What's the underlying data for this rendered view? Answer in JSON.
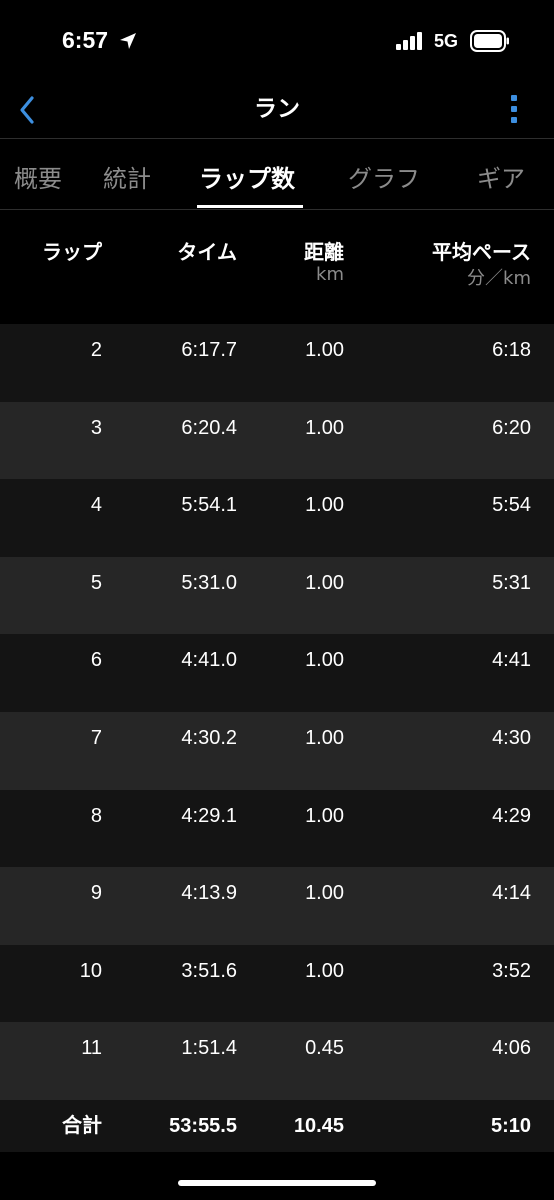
{
  "status_bar": {
    "time": "6:57",
    "network": "5G"
  },
  "nav": {
    "title": "ラン"
  },
  "tabs": [
    {
      "label": "概要"
    },
    {
      "label": "統計"
    },
    {
      "label": "ラップ数"
    },
    {
      "label": "グラフ"
    },
    {
      "label": "ギア"
    }
  ],
  "active_tab": "ラップ数",
  "table": {
    "headers": {
      "lap": "ラップ",
      "time": "タイム",
      "distance": "距離",
      "distance_unit": "km",
      "pace": "平均ペース",
      "pace_unit": "分／km"
    },
    "rows": [
      {
        "lap": "2",
        "time": "6:17.7",
        "distance": "1.00",
        "pace": "6:18"
      },
      {
        "lap": "3",
        "time": "6:20.4",
        "distance": "1.00",
        "pace": "6:20"
      },
      {
        "lap": "4",
        "time": "5:54.1",
        "distance": "1.00",
        "pace": "5:54"
      },
      {
        "lap": "5",
        "time": "5:31.0",
        "distance": "1.00",
        "pace": "5:31"
      },
      {
        "lap": "6",
        "time": "4:41.0",
        "distance": "1.00",
        "pace": "4:41"
      },
      {
        "lap": "7",
        "time": "4:30.2",
        "distance": "1.00",
        "pace": "4:30"
      },
      {
        "lap": "8",
        "time": "4:29.1",
        "distance": "1.00",
        "pace": "4:29"
      },
      {
        "lap": "9",
        "time": "4:13.9",
        "distance": "1.00",
        "pace": "4:14"
      },
      {
        "lap": "10",
        "time": "3:51.6",
        "distance": "1.00",
        "pace": "3:52"
      },
      {
        "lap": "11",
        "time": "1:51.4",
        "distance": "0.45",
        "pace": "4:06"
      }
    ],
    "total": {
      "label": "合計",
      "time": "53:55.5",
      "distance": "10.45",
      "pace": "5:10"
    }
  },
  "colors": {
    "accent": "#3d8fe0",
    "row_dark": "#141414",
    "row_light": "#262626",
    "muted": "#8b8b8b"
  }
}
